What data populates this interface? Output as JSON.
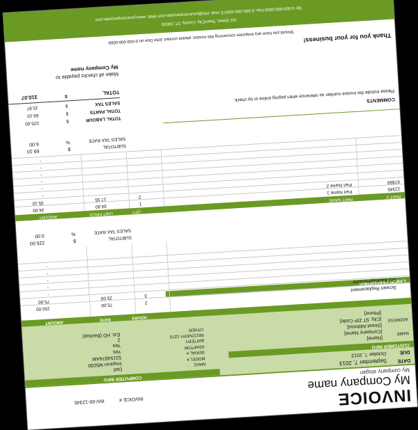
{
  "company": {
    "name": "My Company name",
    "slogan": "My company slogan"
  },
  "invoice": {
    "title": "INVOICE",
    "number_label": "INVOICE #",
    "number": "INV-00-12345",
    "date_label": "DATE",
    "date": "September 7, 2013",
    "due_label": "DUE",
    "due": "October 7, 2013"
  },
  "customer": {
    "section": "CUSTOMER INFO",
    "name_label": "NAME",
    "lines": [
      "[Name]",
      "[Company Name]",
      "[Street Address]",
      "[City, ST ZIP Code]",
      "[Phone]"
    ],
    "address_label": "ADDRESS"
  },
  "computer": {
    "section": "COMPUTER INFO",
    "labels": [
      "MAKE",
      "MODEL #",
      "SERIAL #",
      "ADAPTOR",
      "BATTERY",
      "RECOVERY CD'S",
      "OTHER"
    ],
    "values": [
      "Dell",
      "Inspiron M5030",
      "52154874AM",
      "Yes",
      "Yes",
      "2",
      "Ext. HD (Backup)"
    ]
  },
  "labor": {
    "header": "LABOR PERFORMED",
    "hours_label": "HOURS",
    "rate_label": "RATE",
    "amount_label": "AMOUNT",
    "rows": [
      {
        "desc": "Screen Replacement",
        "hours": "2",
        "rate": "75.00",
        "amount": "150.00"
      },
      {
        "desc": "OS Backup/Restore",
        "hours": "3",
        "rate": "25.00",
        "amount": "75.00"
      },
      {
        "desc": "",
        "hours": "",
        "rate": "",
        "amount": "-"
      },
      {
        "desc": "",
        "hours": "",
        "rate": "",
        "amount": "-"
      },
      {
        "desc": "",
        "hours": "",
        "rate": "",
        "amount": "-"
      },
      {
        "desc": "",
        "hours": "",
        "rate": "",
        "amount": "-"
      },
      {
        "desc": "",
        "hours": "",
        "rate": "",
        "amount": "-"
      }
    ],
    "subtotal_label": "SUBTOTAL",
    "subtotal_cur": "$",
    "subtotal": "225.00",
    "tax_label": "SALES TAX RATE",
    "tax_pct": "%",
    "tax": "0.00"
  },
  "parts": {
    "part_label": "PART #",
    "name_label": "PART NAME",
    "qty_label": "QTY",
    "price_label": "UNIT PRICE",
    "amount_label": "AMOUNT",
    "rows": [
      {
        "part": "12345",
        "name": "Part Name 1",
        "qty": "1",
        "price": "34.00",
        "amount": "34.00"
      },
      {
        "part": "67890",
        "name": "Part Name 2",
        "qty": "2",
        "price": "17.55",
        "amount": "35.10"
      },
      {
        "part": "",
        "name": "",
        "qty": "",
        "price": "",
        "amount": "-"
      },
      {
        "part": "",
        "name": "",
        "qty": "",
        "price": "",
        "amount": "-"
      },
      {
        "part": "",
        "name": "",
        "qty": "",
        "price": "",
        "amount": "-"
      },
      {
        "part": "",
        "name": "",
        "qty": "",
        "price": "",
        "amount": "-"
      },
      {
        "part": "",
        "name": "",
        "qty": "",
        "price": "",
        "amount": "-"
      },
      {
        "part": "",
        "name": "",
        "qty": "",
        "price": "",
        "amount": "-"
      }
    ],
    "subtotal_label": "SUBTOTAL",
    "subtotal_cur": "$",
    "subtotal": "69.10",
    "tax_label": "SALES TAX RATE",
    "tax_pct": "%",
    "tax": "6.00"
  },
  "totals": {
    "labour_label": "TOTAL LABOUR",
    "labour": "225.00",
    "parts_label": "TOTAL PARTS",
    "parts": "69.10",
    "tax_label": "SALES TAX",
    "tax": "15.87",
    "total_label": "TOTAL",
    "total": "310.07",
    "currency": "$"
  },
  "comments": {
    "header": "COMMENTS",
    "text": "Please include the invoice number as reference when paying online or by check."
  },
  "payable": {
    "line1": "Make all checks payable to",
    "line2": "My Company name"
  },
  "footer": {
    "thanks": "Thank you for your business!",
    "question": "Should you have any enquiries concerning this invoice, please contact John Doe on 0-000-000-0000",
    "address": "111 Street, Town/City, County, ST, 00000",
    "contact": "Tel: 0-000-000-0000 Fax: 0-000-000-0000 E-mail: info@yourcompanysite.com Web: www.yourcompanysite.com"
  }
}
